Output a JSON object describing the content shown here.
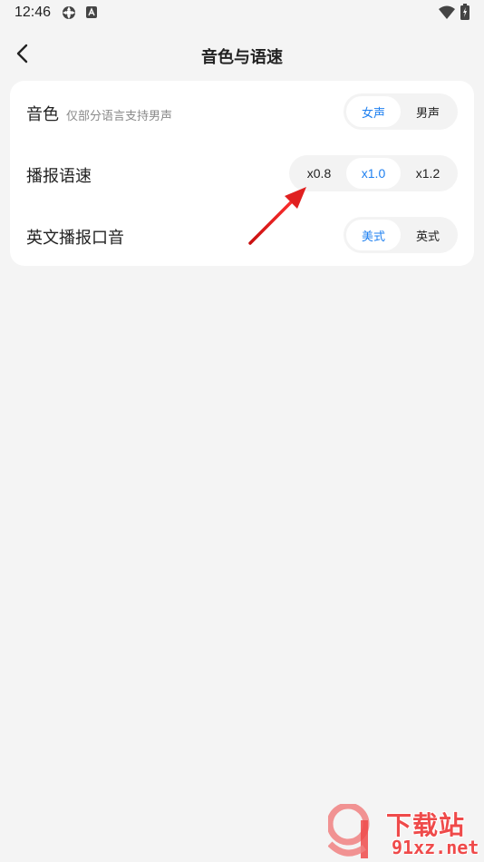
{
  "status_bar": {
    "time": "12:46",
    "icons": [
      "app-notification-icon",
      "a-badge-icon",
      "wifi-icon",
      "battery-charging-icon"
    ]
  },
  "header": {
    "title": "音色与语速",
    "back_icon": "chevron-left-icon"
  },
  "settings": {
    "voice": {
      "label": "音色",
      "hint": "仅部分语言支持男声",
      "options": [
        "女声",
        "男声"
      ],
      "selected": "女声"
    },
    "speed": {
      "label": "播报语速",
      "options": [
        "x0.8",
        "x1.0",
        "x1.2"
      ],
      "selected": "x1.0"
    },
    "accent": {
      "label": "英文播报口音",
      "options": [
        "美式",
        "英式"
      ],
      "selected": "美式"
    }
  },
  "colors": {
    "accent": "#1f80f0",
    "background": "#f4f4f4",
    "card": "#ffffff",
    "annotation": "#e02020"
  },
  "watermark": {
    "text": "下载站",
    "domain": "91xz.net"
  }
}
